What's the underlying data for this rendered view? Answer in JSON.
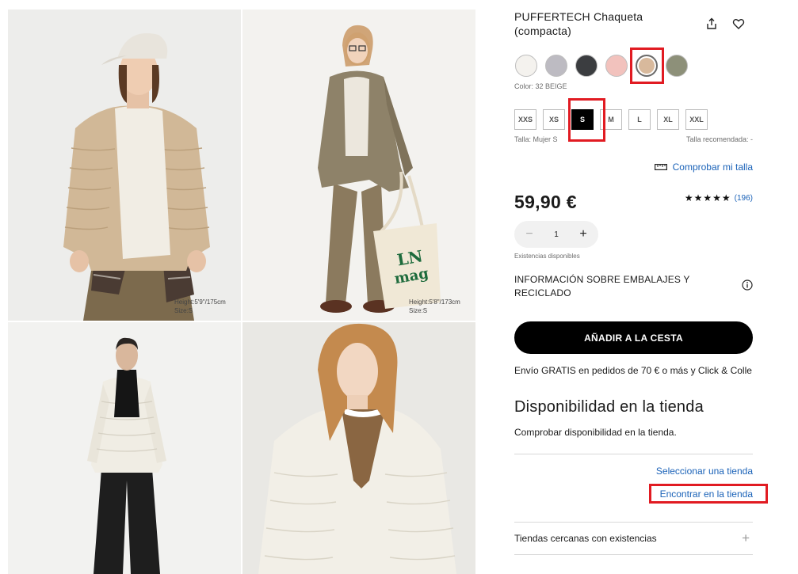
{
  "gallery": {
    "photo1_caption": [
      "Height:5'9\"/175cm",
      "Size:S"
    ],
    "photo2_caption": [
      "Height:5'8\"/173cm",
      "Size:S"
    ],
    "bag_text": "LN mag"
  },
  "product": {
    "title": "PUFFERTECH Chaqueta (compacta)",
    "share_icon": "share-icon",
    "favorite_icon": "heart-icon",
    "colors": [
      {
        "name": "off-white",
        "hex": "#f4f2ee"
      },
      {
        "name": "light-gray",
        "hex": "#bdbbc2"
      },
      {
        "name": "dark-gray",
        "hex": "#3b3d40"
      },
      {
        "name": "pink",
        "hex": "#f2c2bd"
      },
      {
        "name": "beige",
        "hex": "#d8b99c",
        "selected": true
      },
      {
        "name": "olive",
        "hex": "#8d9079"
      }
    ],
    "color_label": "Color: 32 BEIGE",
    "sizes": [
      "XXS",
      "XS",
      "S",
      "M",
      "L",
      "XL",
      "XXL"
    ],
    "selected_size": "S",
    "size_label": "Talla: Mujer S",
    "size_reco": "Talla recomendada: -",
    "check_size": "Comprobar mi talla",
    "price": "59,90 €",
    "stars": "★★★★★",
    "reviews": "(196)",
    "quantity": "1",
    "stock": "Existencias disponibles",
    "packaging": "INFORMACIÓN SOBRE EMBALAJES Y RECICLADO",
    "add_to_cart": "AÑADIR A LA CESTA",
    "shipping": "Envío GRATIS en pedidos de 70 € o más y Click & Colle"
  },
  "availability": {
    "title": "Disponibilidad en la tienda",
    "subtitle": "Comprobar disponibilidad en la tienda.",
    "select_store": "Seleccionar una tienda",
    "find_in_store": "Encontrar en la tienda",
    "nearby": "Tiendas cercanas con existencias",
    "nearby_toggle": "+"
  },
  "colors": {
    "link": "#1a62b8",
    "highlight": "#e11b22",
    "cta": "#000000"
  }
}
